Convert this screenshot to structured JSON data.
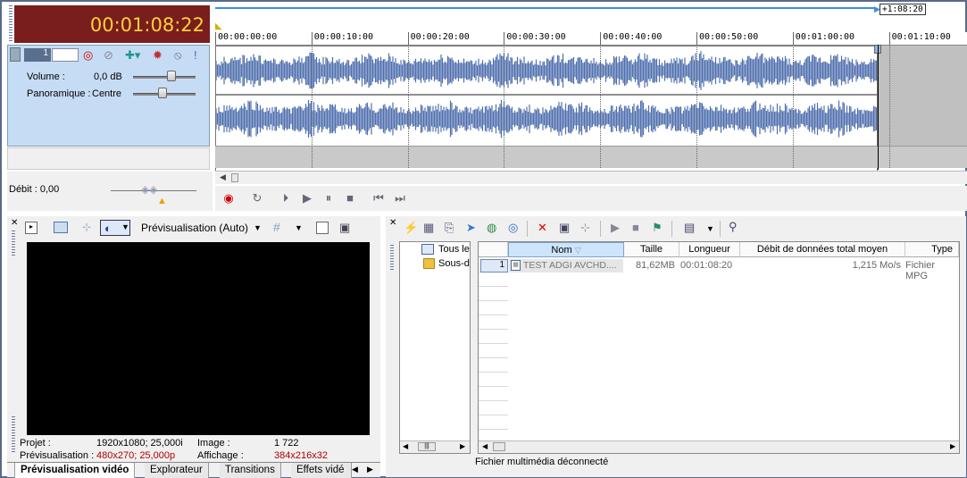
{
  "timecode": "00:01:08:22",
  "end_marker": "+1:08:20",
  "ruler_ticks": [
    "00:00:00:00",
    "00:00:10:00",
    "00:00:20:00",
    "00:00:30:00",
    "00:00:40:00",
    "00:00:50:00",
    "00:01:00:00",
    "00:01:10:00"
  ],
  "track": {
    "number": "1",
    "volume_label": "Volume :",
    "volume_value": "0,0 dB",
    "pan_label": "Panoramique :",
    "pan_value": "Centre"
  },
  "debit": "Débit : 0,00",
  "preview": {
    "mode": "Prévisualisation (Auto)",
    "projet_label": "Projet :",
    "projet_value": "1920x1080; 25,000i",
    "image_label": "Image :",
    "image_value": "1 722",
    "previs_label": "Prévisualisation :",
    "previs_value": "480x270; 25,000p",
    "affichage_label": "Affichage :",
    "affichage_value": "384x216x32"
  },
  "tabs": [
    "Prévisualisation vidéo",
    "Explorateur",
    "Transitions",
    "Effets vidé"
  ],
  "tree": [
    "Tous le",
    "Sous-d"
  ],
  "columns": [
    "Nom",
    "Taille",
    "Longueur",
    "Débit de données total moyen",
    "Type"
  ],
  "rows": [
    {
      "num": "1",
      "name": "TEST  ADGI AVCHD....",
      "size": "81,62MB",
      "length": "00:01:08:20",
      "rate": "1,215 Mo/s",
      "type": "Fichier MPG"
    }
  ],
  "status": "Fichier multimédia déconnecté",
  "colors": {
    "timecode_bg": "#7a1d1d",
    "timecode_fg": "#ffd23a",
    "track_bg": "#c6dcf5",
    "wave": "#4f6fae"
  }
}
